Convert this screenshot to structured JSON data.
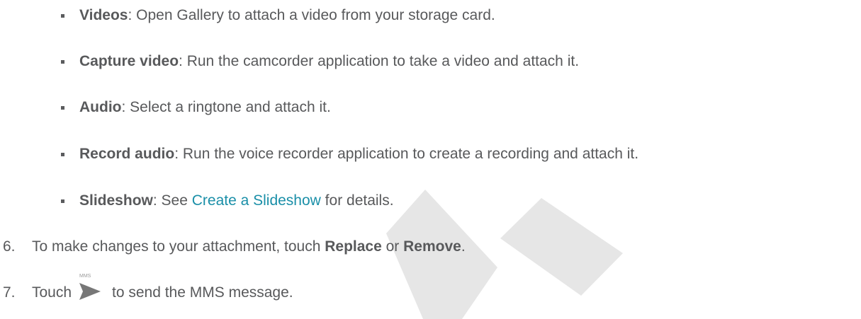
{
  "watermark_color": "#e6e6e6",
  "bullets": [
    {
      "bold": "Videos",
      "text": ": Open Gallery to attach a video from your storage card."
    },
    {
      "bold": "Capture video",
      "text": ": Run the camcorder application to take a video and attach it."
    },
    {
      "bold": "Audio",
      "text": ": Select a ringtone and attach it."
    },
    {
      "bold": "Record audio",
      "text": ": Run the voice recorder application to create a recording and attach it."
    }
  ],
  "slideshow": {
    "bold": "Slideshow",
    "pre": ": See ",
    "link": "Create a Slideshow",
    "post": " for details."
  },
  "step6": {
    "number": "6.",
    "pre": "To make changes to your attachment, touch ",
    "bold1": "Replace",
    "mid": " or ",
    "bold2": "Remove",
    "post": "."
  },
  "step7": {
    "number": "7.",
    "pre": "Touch",
    "icon_label": "MMS",
    "icon_name": "send-icon",
    "post": "to send the MMS message."
  }
}
